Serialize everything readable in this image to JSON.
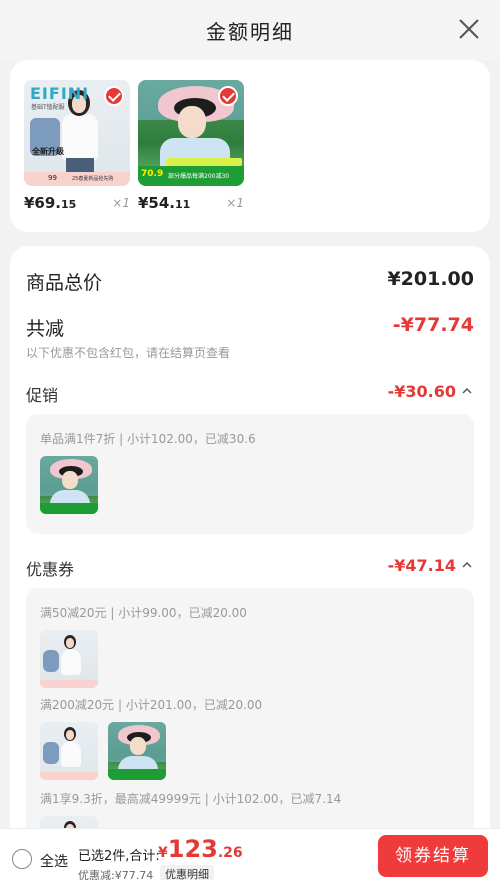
{
  "header": {
    "title": "金额明细",
    "close_icon": "close-icon"
  },
  "products": [
    {
      "image": "white-tshirt-photo",
      "brand": "EIFINI",
      "subtitle": "基础T恤配服",
      "tag": "全新升级",
      "bar_price": "99",
      "bar_text": "25春夏新品抢先购",
      "selected": true,
      "price_int": "¥69.",
      "price_dec": "15",
      "qty": "×1"
    },
    {
      "image": "sun-hat-photo",
      "band_price": "70.9",
      "band_text": "部分爆品每满200减30",
      "selected": true,
      "price_int": "¥54.",
      "price_dec": "11",
      "qty": "×1"
    }
  ],
  "summary": {
    "total_label": "商品总价",
    "total_value": "¥201.00",
    "reduce_label": "共减",
    "reduce_value": "-¥77.74",
    "reduce_note": "以下优惠不包含红包，请在结算页查看"
  },
  "promotion": {
    "label": "促销",
    "value": "-¥30.60",
    "expanded": true,
    "rule": "单品满1件7折 | 小计102.00，已减30.6"
  },
  "coupon": {
    "label": "优惠券",
    "value": "-¥47.14",
    "expanded": true,
    "rules": [
      "满50减20元 | 小计99.00，已减20.00",
      "满200减20元 | 小计201.00，已减20.00",
      "满1享9.3折，最高减49999元 | 小计102.00，已减7.14"
    ]
  },
  "footer": {
    "select_all": "全选",
    "selected_text": "已选2件,合计:",
    "total_currency": "¥",
    "total_int": "123",
    "total_dec": ".26",
    "discount_text": "优惠减:¥77.74",
    "detail_link": "优惠明细",
    "checkout_button": "领券结算"
  },
  "colors": {
    "accent": "#e53935",
    "button": "#ef3b3b"
  }
}
